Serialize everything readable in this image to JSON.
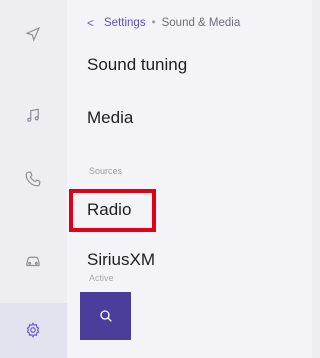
{
  "breadcrumb": {
    "back_glyph": "<",
    "root": "Settings",
    "separator": "•",
    "current": "Sound & Media"
  },
  "menu": {
    "items": [
      {
        "label": "Sound tuning"
      },
      {
        "label": "Media"
      },
      {
        "label": "Radio"
      },
      {
        "label": "SiriusXM",
        "sublabel": "Active"
      }
    ],
    "section_label": "Sources"
  },
  "rail": {
    "icons": [
      "navigation-icon",
      "music-icon",
      "phone-icon",
      "car-icon",
      "settings-icon"
    ],
    "active": "settings-icon"
  },
  "search": {
    "icon": "search-icon"
  },
  "colors": {
    "accent": "#5b4fd0",
    "search_bg": "#4b3e9a",
    "highlight": "#e0001a"
  }
}
